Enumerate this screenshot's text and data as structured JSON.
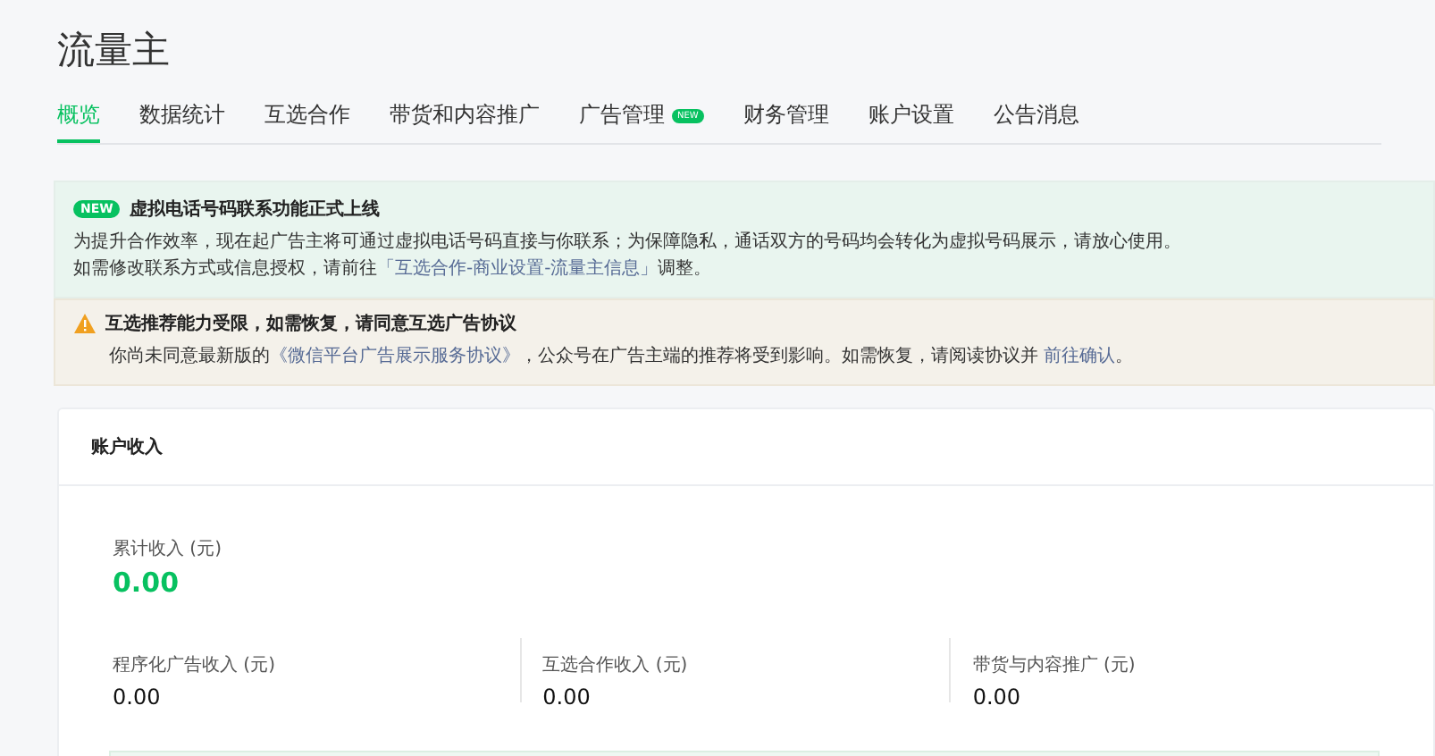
{
  "title": "流量主",
  "tabs": [
    {
      "label": "概览",
      "selected": true
    },
    {
      "label": "数据统计",
      "selected": false
    },
    {
      "label": "互选合作",
      "selected": false
    },
    {
      "label": "带货和内容推广",
      "selected": false
    },
    {
      "label": "广告管理",
      "selected": false,
      "badge": "NEW"
    },
    {
      "label": "财务管理",
      "selected": false
    },
    {
      "label": "账户设置",
      "selected": false
    },
    {
      "label": "公告消息",
      "selected": false
    }
  ],
  "notices": [
    {
      "kind": "info",
      "badge": "NEW",
      "title": "虚拟电话号码联系功能正式上线",
      "lines": [
        [
          {
            "kind": "text",
            "text": "为提升合作效率，现在起广告主将可通过虚拟电话号码直接与你联系；为保障隐私，通话双方的号码均会转化为虚拟号码展示，请放心使用。"
          }
        ],
        [
          {
            "kind": "text",
            "text": "如需修改联系方式或信息授权，请前往"
          },
          {
            "kind": "link",
            "text": "「互选合作-商业设置-流量主信息」"
          },
          {
            "kind": "text",
            "text": "调整。"
          }
        ]
      ]
    },
    {
      "kind": "warning",
      "title": "互选推荐能力受限，如需恢复，请同意互选广告协议",
      "lines": [
        [
          {
            "kind": "text",
            "text": "你尚未同意最新版的"
          },
          {
            "kind": "link",
            "text": "《微信平台广告展示服务协议》"
          },
          {
            "kind": "text",
            "text": "，公众号在广告主端的推荐将受到影响。如需恢复，请阅读协议并 "
          },
          {
            "kind": "link",
            "text": "前往确认"
          },
          {
            "kind": "text",
            "text": "。"
          }
        ]
      ]
    }
  ],
  "income": {
    "heading": "账户收入",
    "total": {
      "label": "累计收入 (元)",
      "value": "0.00"
    },
    "items": [
      {
        "label": "程序化广告收入 (元)",
        "value": "0.00"
      },
      {
        "label": "互选合作收入 (元)",
        "value": "0.00"
      },
      {
        "label": "带货与内容推广 (元)",
        "value": "0.00"
      }
    ]
  }
}
